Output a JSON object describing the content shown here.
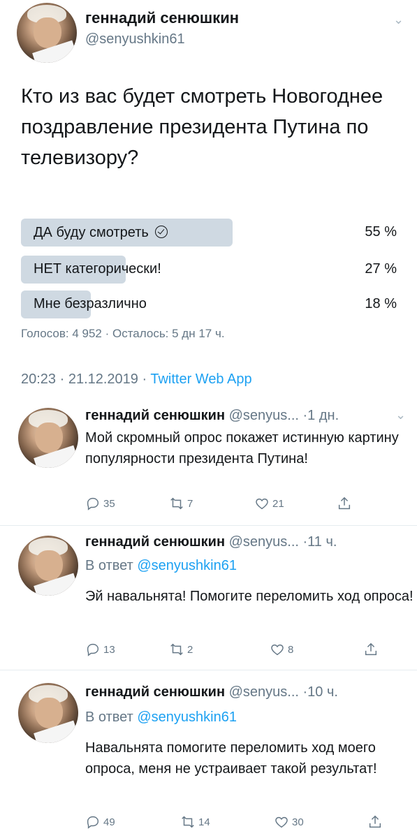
{
  "tweet": {
    "author_name": "геннадий сенюшкин",
    "author_handle": "@senyushkin61",
    "text": "Кто из вас будет смотреть Новогоднее поздравление президента Путина по телевизору?",
    "poll": {
      "options": [
        {
          "label": "ДА буду смотреть",
          "percent_text": "55 %",
          "percent": 55,
          "selected": true
        },
        {
          "label": "НЕТ категорически!",
          "percent_text": "27 %",
          "percent": 27,
          "selected": false
        },
        {
          "label": "Мне безразлично",
          "percent_text": "18 %",
          "percent": 18,
          "selected": false
        }
      ],
      "meta": "Голосов: 4 952 · Осталось: 5 дн 17 ч."
    },
    "timestamp": "20:23 · 21.12.2019 · ",
    "source_app": "Twitter Web App"
  },
  "replies": [
    {
      "name": "геннадий сенюшкин",
      "handle_time": "@senyus... ·1 дн.",
      "in_reply_prefix": "",
      "in_reply_mention": "",
      "text": "Мой скромный опрос покажет истинную картину популярности президента Путина!",
      "replies": "35",
      "retweets": "7",
      "likes": "21"
    },
    {
      "name": "геннадий сенюшкин",
      "handle_time": "@senyus... ·11 ч.",
      "in_reply_prefix": "В ответ ",
      "in_reply_mention": "@senyushkin61",
      "text": "Эй навальнята! Помогите переломить ход опроса!",
      "replies": "13",
      "retweets": "2",
      "likes": "8"
    },
    {
      "name": "геннадий сенюшкин",
      "handle_time": "@senyus... ·10 ч.",
      "in_reply_prefix": "В ответ ",
      "in_reply_mention": "@senyushkin61",
      "text": "Навальнята помогите переломить ход моего опроса, меня не устраивает такой результат!",
      "replies": "49",
      "retweets": "14",
      "likes": "30"
    }
  ],
  "colors": {
    "accent": "#1da1f2",
    "muted": "#657786",
    "poll_bar": "#cfd9e2"
  },
  "icons": [
    "chevron-down-icon",
    "check-circle-icon",
    "reply-icon",
    "retweet-icon",
    "like-icon",
    "share-icon"
  ]
}
